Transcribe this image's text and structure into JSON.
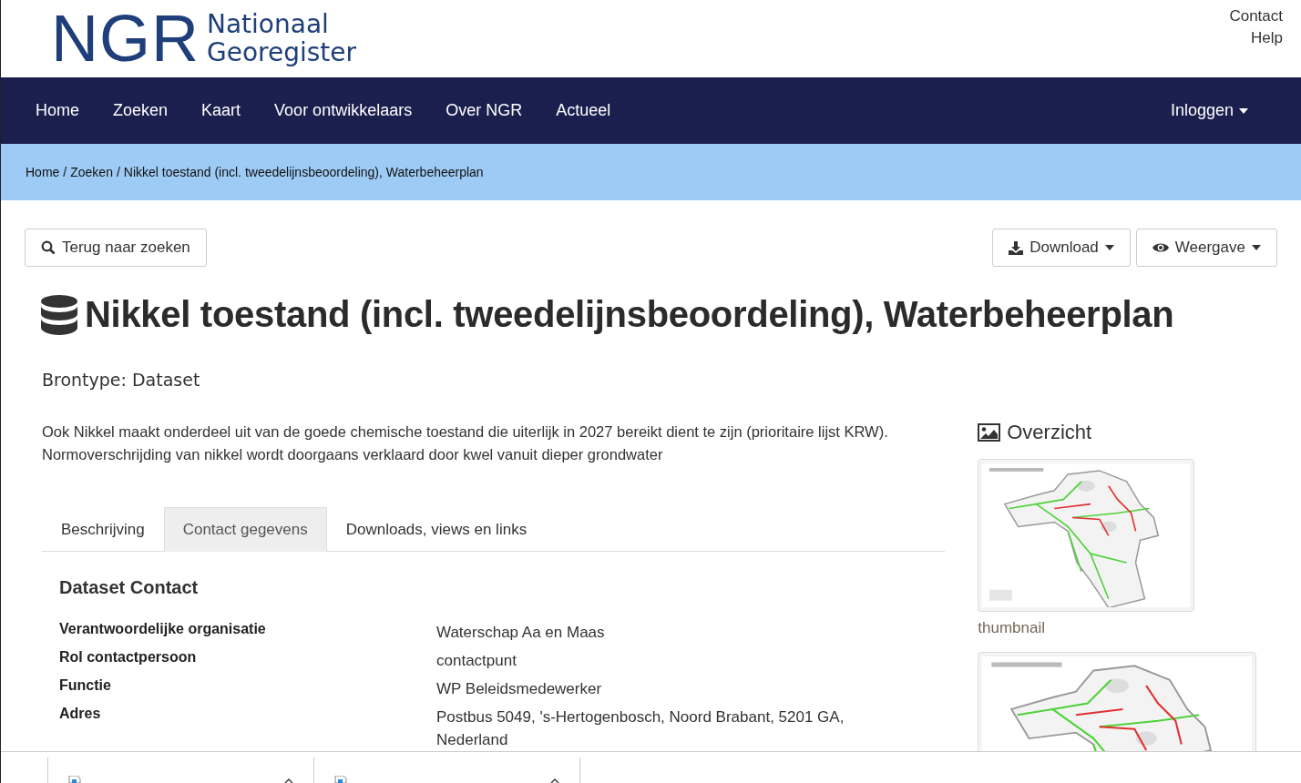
{
  "header": {
    "logo": {
      "abbr": "NGR",
      "line1": "Nationaal",
      "line2": "Georegister"
    },
    "top_links": [
      "Contact",
      "Help"
    ]
  },
  "nav": {
    "items": [
      "Home",
      "Zoeken",
      "Kaart",
      "Voor ontwikkelaars",
      "Over NGR",
      "Actueel"
    ],
    "login": "Inloggen"
  },
  "breadcrumb": {
    "separator": "/",
    "items": [
      "Home",
      "Zoeken",
      "Nikkel toestand (incl. tweedelijnsbeoordeling), Waterbeheerplan"
    ]
  },
  "toolbar": {
    "back": "Terug naar zoeken",
    "download": "Download",
    "view": "Weergave"
  },
  "title": "Nikkel toestand (incl. tweedelijnsbeoordeling), Waterbeheerplan",
  "source_type": "Brontype: Dataset",
  "description": "Ook Nikkel maakt onderdeel uit van de goede chemische toestand die uiterlijk in 2027 bereikt dient te zijn (prioritaire lijst KRW). Normoverschrijding van nikkel wordt doorgaans verklaard door kwel vanuit dieper grondwater",
  "tabs": [
    {
      "label": "Beschrijving",
      "selected": false
    },
    {
      "label": "Contact gegevens",
      "selected": true
    },
    {
      "label": "Downloads, views en links",
      "selected": false
    }
  ],
  "contact": {
    "heading": "Dataset Contact",
    "rows": [
      {
        "label": "Verantwoordelijke organisatie",
        "value": "Waterschap Aa en Maas"
      },
      {
        "label": "Rol contactpersoon",
        "value": "contactpunt"
      },
      {
        "label": "Functie",
        "value": "WP Beleidsmedewerker"
      },
      {
        "label": "Adres",
        "value": "Postbus 5049, 's-Hertogenbosch, Noord Brabant, 5201 GA, Nederland"
      }
    ]
  },
  "overview": {
    "heading": "Overzicht",
    "thumbnails": [
      {
        "kind": "picture",
        "caption": "thumbnail"
      },
      {
        "kind": "picture"
      }
    ]
  },
  "download_shelf": {
    "items": [
      {
        "kind": "file"
      },
      {
        "kind": "file"
      }
    ]
  }
}
